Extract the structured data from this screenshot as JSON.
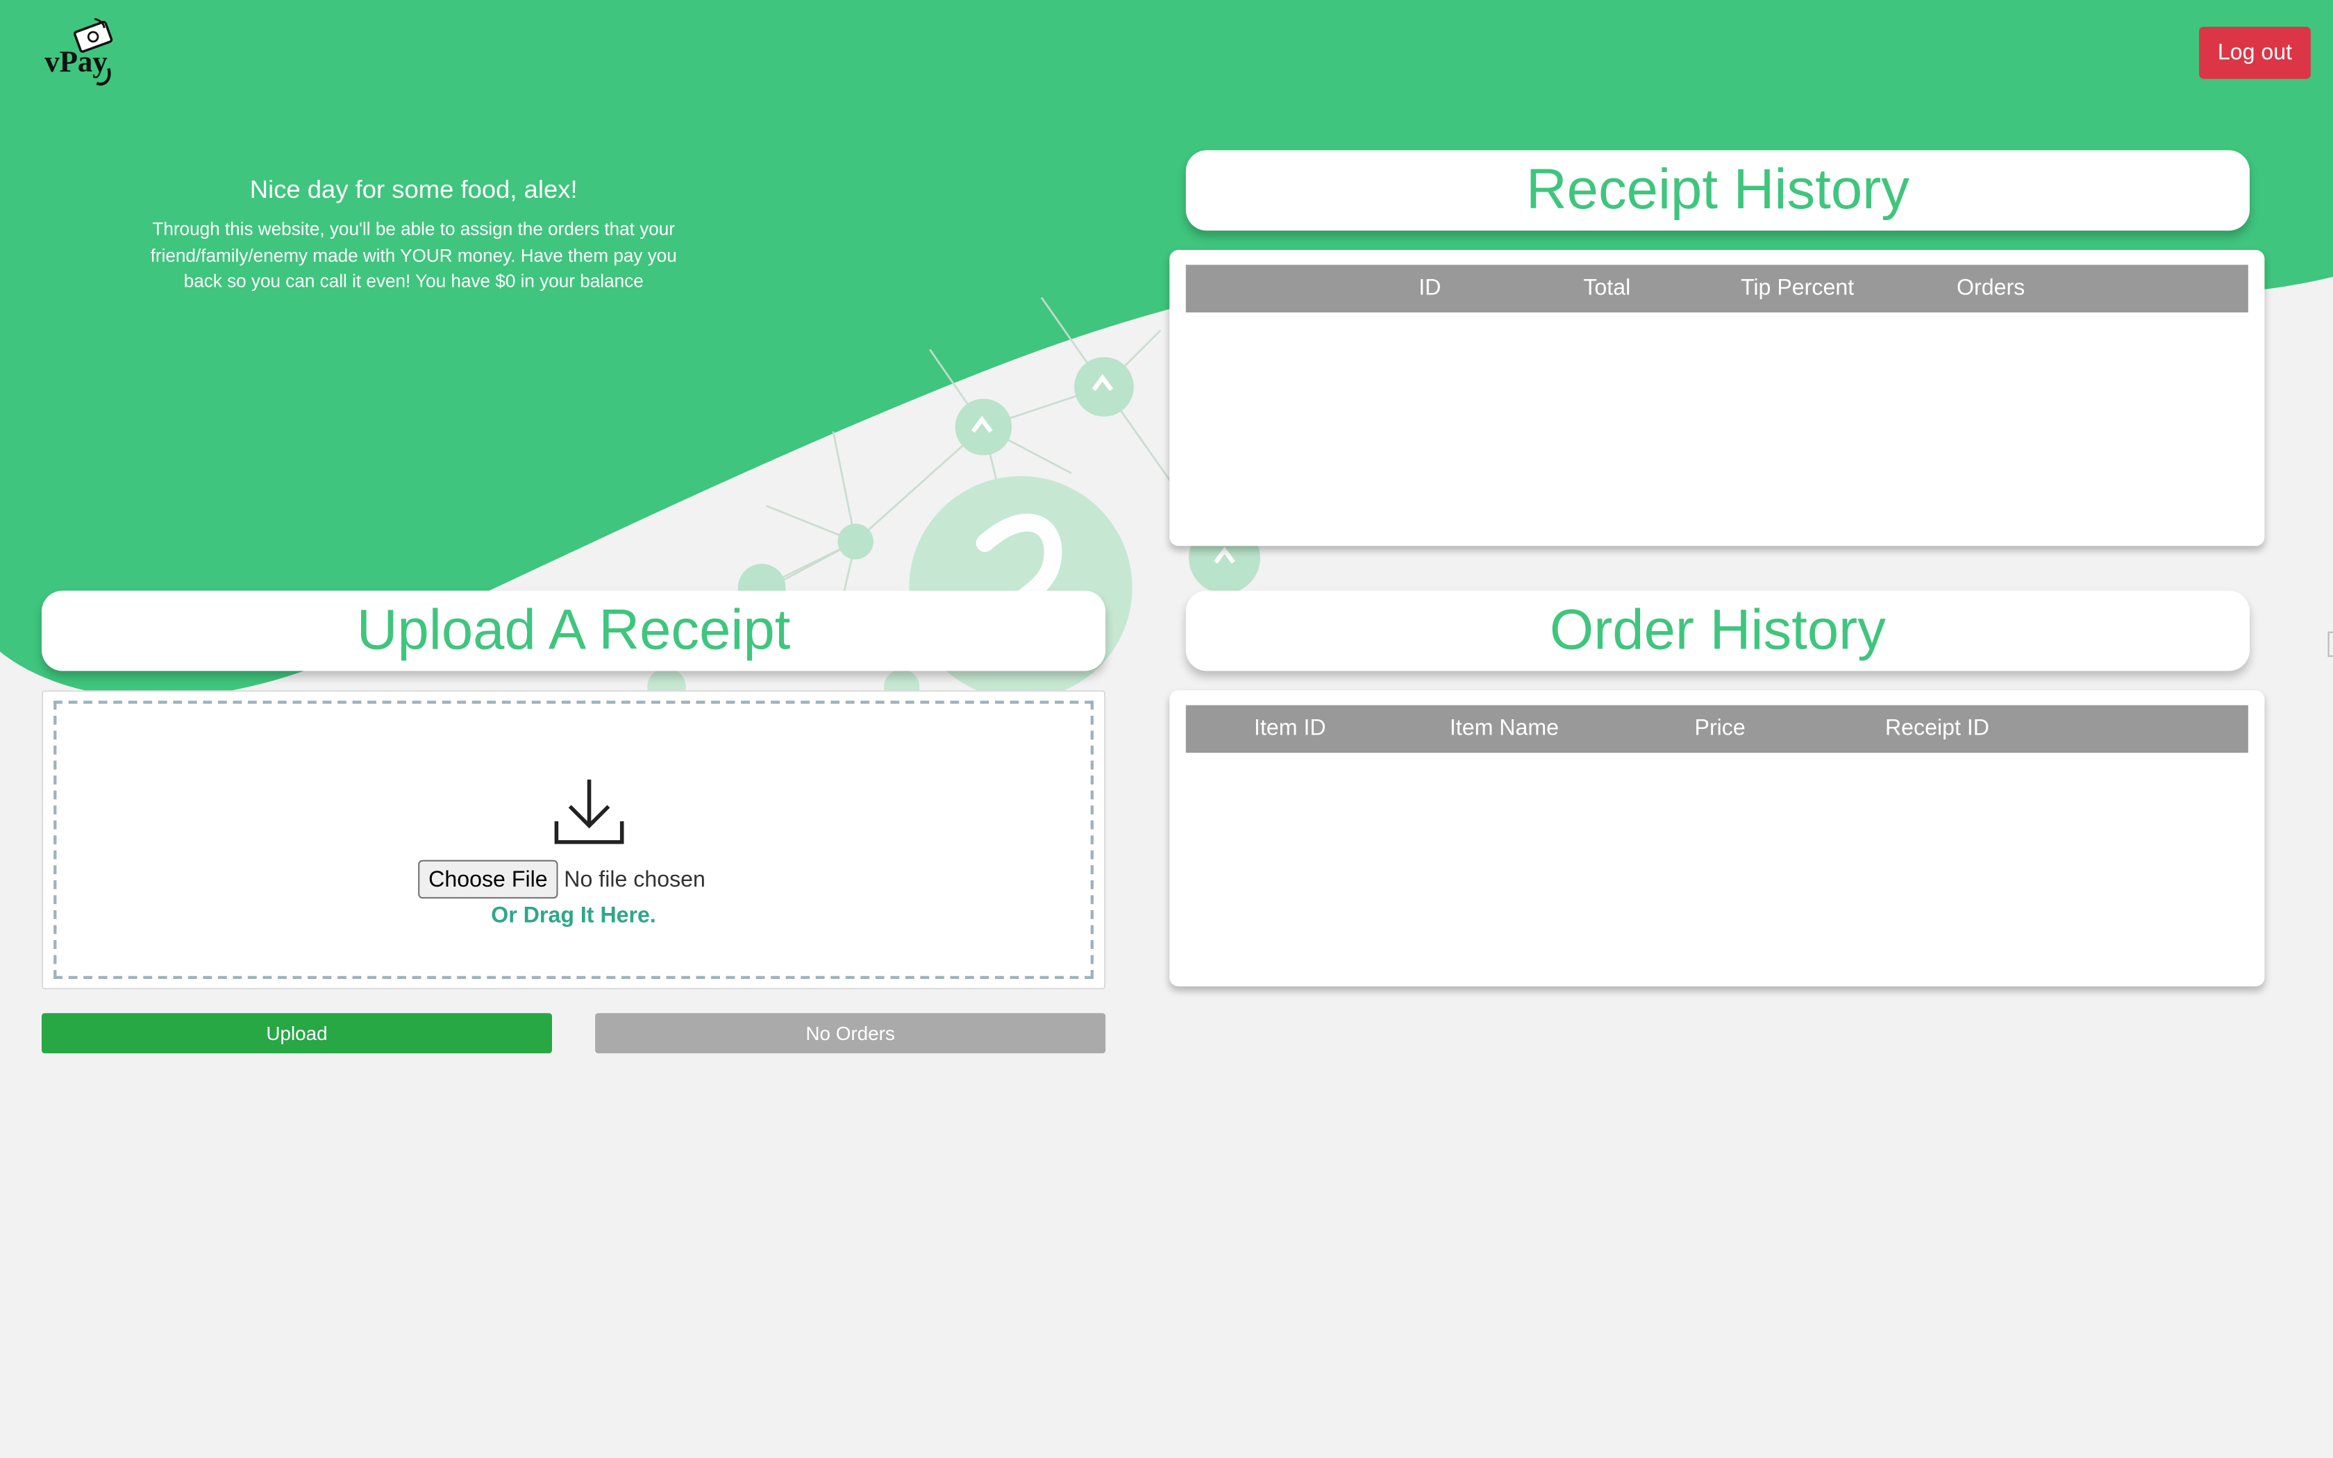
{
  "app": {
    "name": "vPay"
  },
  "header": {
    "logout_label": "Log out"
  },
  "greeting": {
    "title": "Nice day for some food, alex!",
    "body": "Through this website, you'll be able to assign the orders that your friend/family/enemy made with YOUR money. Have them pay you back so you can call it even! You have $0 in your balance"
  },
  "receipt_history": {
    "title": "Receipt History",
    "columns": [
      "ID",
      "Total",
      "Tip Percent",
      "Orders"
    ],
    "rows": []
  },
  "order_history": {
    "title": "Order History",
    "columns": [
      "Item ID",
      "Item Name",
      "Price",
      "Receipt ID"
    ],
    "rows": []
  },
  "upload": {
    "title": "Upload A Receipt",
    "choose_file_label": "Choose File",
    "file_status": "No file chosen",
    "drag_text": "Or Drag It Here.",
    "upload_button": "Upload",
    "no_orders_button": "No Orders"
  },
  "colors": {
    "brand_green": "#3fc57d",
    "logout_red": "#dc3545",
    "upload_green": "#28a745",
    "table_header_gray": "#999999",
    "disabled_gray": "#aaaaaa"
  },
  "icons": [
    "vpay-logo",
    "download-icon",
    "network-decoration"
  ]
}
